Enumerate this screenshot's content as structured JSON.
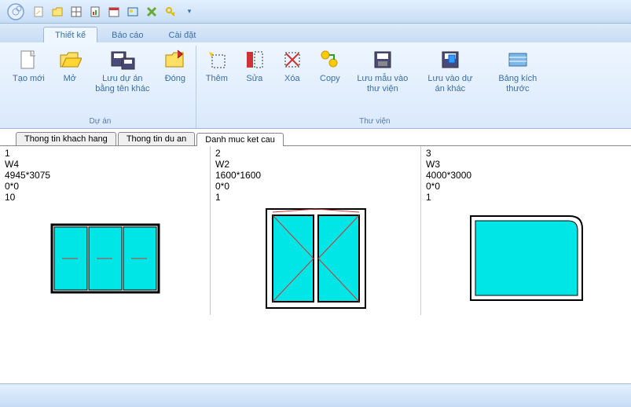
{
  "ribbonTabs": {
    "design": "Thiết kế",
    "report": "Báo cáo",
    "settings": "Cài đặt"
  },
  "ribbon": {
    "group1": {
      "new": "Tạo mới",
      "open": "Mở",
      "saveAs": "Lưu dự án bằng tên khác",
      "close": "Đóng",
      "title": "Dự án"
    },
    "group2": {
      "add": "Thêm",
      "edit": "Sửa",
      "delete": "Xóa",
      "copy": "Copy",
      "saveLib": "Lưu mẫu vào thư viện",
      "saveOther": "Lưu vào dự án khác",
      "dimTable": "Bảng kích  thước",
      "title": "Thư viện"
    }
  },
  "contentTabs": {
    "customer": "Thong tin khach hang",
    "project": "Thong tin du an",
    "structures": "Danh muc ket cau"
  },
  "items": [
    {
      "idx": "1",
      "code": "W4",
      "size": "4945*3075",
      "pos": "0*0",
      "qty": "10"
    },
    {
      "idx": "2",
      "code": "W2",
      "size": "1600*1600",
      "pos": "0*0",
      "qty": "1"
    },
    {
      "idx": "3",
      "code": "W3",
      "size": "4000*3000",
      "pos": "0*0",
      "qty": "1"
    }
  ]
}
